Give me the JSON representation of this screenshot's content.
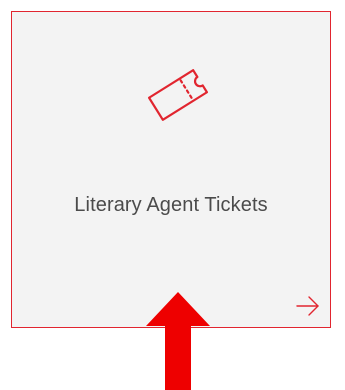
{
  "card": {
    "label": "Literary Agent Tickets",
    "icon": "ticket-icon",
    "link_icon": "arrow-right-icon",
    "accent_color": "#e1252f",
    "background_color": "#f3f3f3"
  },
  "annotation": {
    "icon": "red-up-arrow",
    "color": "#ee0000"
  }
}
